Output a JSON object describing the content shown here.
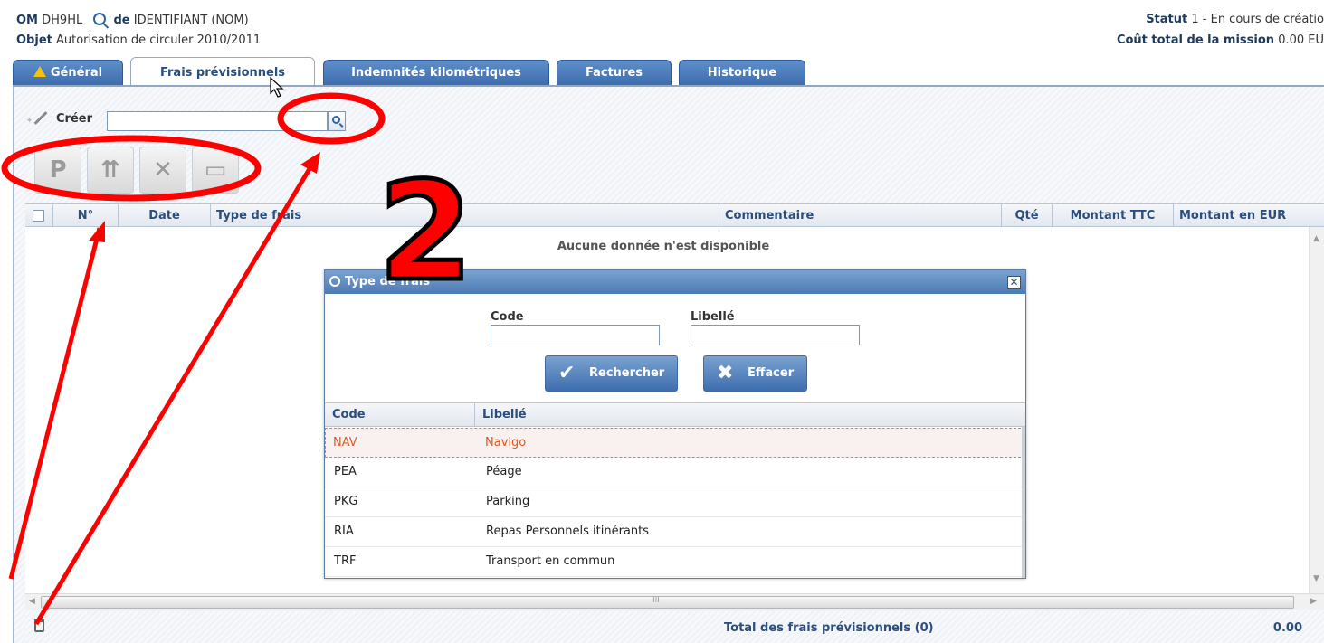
{
  "header": {
    "om_label": "OM",
    "om_value": "DH9HL",
    "de_label": "de",
    "de_value": "IDENTIFIANT (NOM)",
    "objet_label": "Objet",
    "objet_value": "Autorisation de circuler 2010/2011",
    "statut_label": "Statut",
    "statut_value": "1 - En cours de créatio",
    "cout_label": "Coût total de la mission",
    "cout_value": "0.00 EU"
  },
  "tabs": [
    {
      "label": "Général",
      "warning": true
    },
    {
      "label": "Frais prévisionnels",
      "active": true
    },
    {
      "label": "Indemnités kilométriques"
    },
    {
      "label": "Factures"
    },
    {
      "label": "Historique"
    }
  ],
  "toolbar": {
    "creer_label": "Créer",
    "creer_value": "",
    "quick_buttons": [
      {
        "icon": "parking-icon",
        "glyph": "P"
      },
      {
        "icon": "highway-icon",
        "glyph": "⇈"
      },
      {
        "icon": "restaurant-icon",
        "glyph": "✕"
      },
      {
        "icon": "bus-icon",
        "glyph": "▭"
      }
    ]
  },
  "grid": {
    "columns": [
      "N°",
      "Date",
      "Type de frais",
      "Commentaire",
      "Qté",
      "Montant TTC",
      "Montant en EUR"
    ],
    "empty_message": "Aucune donnée n'est disponible",
    "scroll_grip": "III"
  },
  "footer": {
    "total_label": "Total des frais prévisionnels (0)",
    "total_value": "0.00"
  },
  "dialog": {
    "title": "Type de frais",
    "close_glyph": "✕",
    "code_label": "Code",
    "code_value": "",
    "libelle_label": "Libellé",
    "libelle_value": "",
    "search_button": "Rechercher",
    "clear_button": "Effacer",
    "columns": [
      "Code",
      "Libellé"
    ],
    "rows": [
      {
        "code": "NAV",
        "libelle": "Navigo",
        "selected": true
      },
      {
        "code": "PEA",
        "libelle": "Péage"
      },
      {
        "code": "PKG",
        "libelle": "Parking"
      },
      {
        "code": "RIA",
        "libelle": "Repas Personnels itinérants"
      },
      {
        "code": "TRF",
        "libelle": "Transport en commun"
      }
    ]
  },
  "annotation": {
    "step_number": "2",
    "color": "#ff0000"
  }
}
